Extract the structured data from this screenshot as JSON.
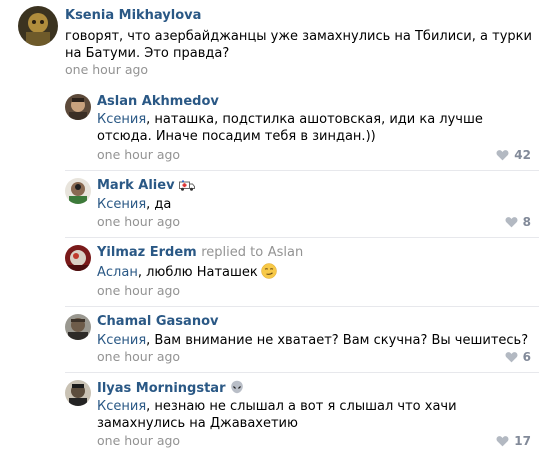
{
  "comments": [
    {
      "author": "Ksenia Mikhaylova",
      "text": "говорят, что азербайджанцы уже замахнулись на Тбилиси, а турки на Батуми. Это правда?",
      "time": "one hour ago"
    },
    {
      "author": "Aslan Akhmedov",
      "mention": "Ксения",
      "text": ", наташка, подстилка ашотовская, иди ка лучше отсюда. Иначе посадим тебя в зиндан.))",
      "time": "one hour ago",
      "likes": "42"
    },
    {
      "author": "Mark Aliev",
      "badge_icon": "ambulance-icon",
      "mention": "Ксения",
      "text": ", да",
      "time": "one hour ago",
      "likes": "8"
    },
    {
      "author": "Yilmaz Erdem",
      "replied_to_label": "replied to",
      "replied_to_name": "Aslan",
      "mention": "Аслан",
      "text": ", люблю Наташек",
      "emoji_icon": "smirk-emoji-icon",
      "time": "one hour ago"
    },
    {
      "author": "Chamal Gasanov",
      "mention": "Ксения",
      "text": ", Вам внимание не хватает? Вам скучна? Вы чешитесь?",
      "time": "one hour ago",
      "likes": "6"
    },
    {
      "author": "Ilyas Morningstar",
      "badge_icon": "alien-icon",
      "mention": "Ксения",
      "text": ", незнаю не слышал а вот я слышал что хачи замахнулись на Джавахетию",
      "time": "one hour ago",
      "likes": "17"
    }
  ],
  "colors": {
    "link": "#2a5885",
    "meta": "#939393",
    "like": "#828a99",
    "divider": "#e7e8ec"
  }
}
